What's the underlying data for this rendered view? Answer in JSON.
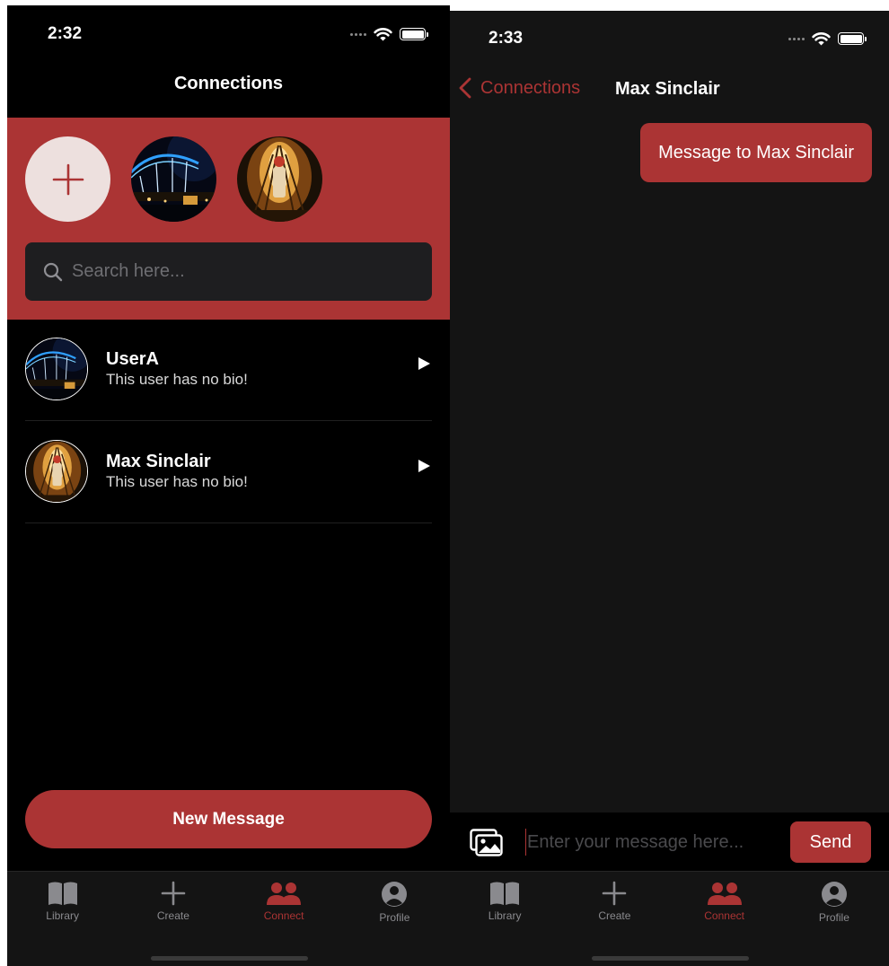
{
  "left": {
    "status_time": "2:32",
    "nav_title": "Connections",
    "search_placeholder": "Search here...",
    "connections": [
      {
        "name": "UserA",
        "bio": "This user has no bio!"
      },
      {
        "name": "Max Sinclair",
        "bio": "This user has no bio!"
      }
    ],
    "new_message_label": "New Message"
  },
  "right": {
    "status_time": "2:33",
    "back_label": "Connections",
    "chat_title": "Max Sinclair",
    "messages": [
      {
        "text": "Message to Max Sinclair",
        "from_me": true
      }
    ],
    "composer_placeholder": "Enter your message here...",
    "send_label": "Send"
  },
  "tabs": [
    {
      "label": "Library",
      "icon": "book-icon"
    },
    {
      "label": "Create",
      "icon": "plus-icon"
    },
    {
      "label": "Connect",
      "icon": "people-icon",
      "active": true
    },
    {
      "label": "Profile",
      "icon": "person-circle-icon"
    }
  ],
  "colors": {
    "accent": "#ab3434",
    "background": "#000000",
    "chat_background": "#141414",
    "add_story_fill": "#ede0de",
    "inactive_tab": "#8a8a8e"
  }
}
